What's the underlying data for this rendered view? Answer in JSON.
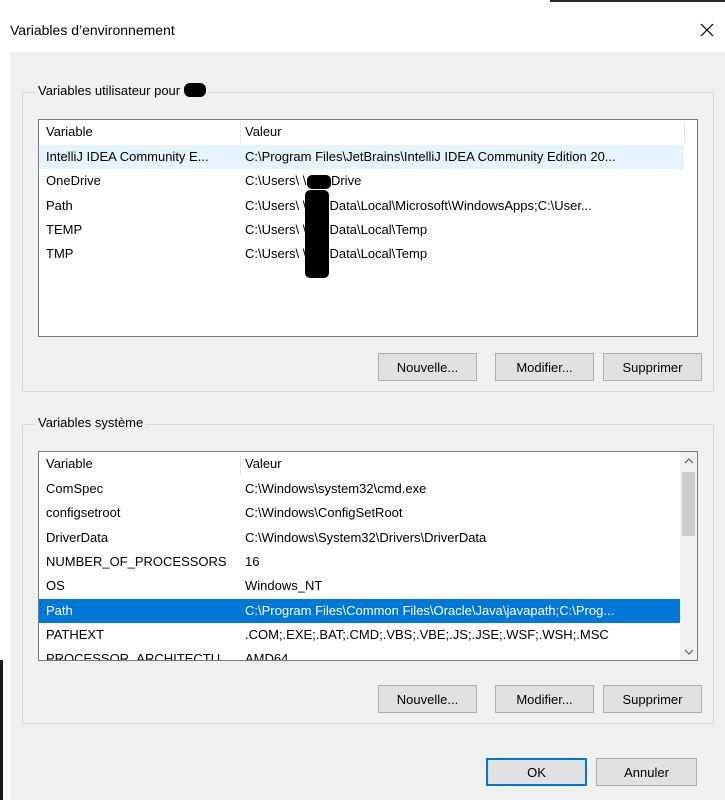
{
  "window": {
    "title": "Variables d’environnement",
    "close_glyph": "✕"
  },
  "user_section": {
    "legend": "Variables utilisateur pour",
    "columns": [
      "Variable",
      "Valeur"
    ],
    "rows": [
      {
        "name": "IntelliJ IDEA Community E...",
        "value": "C:\\Program Files\\JetBrains\\IntelliJ IDEA Community Edition 20..."
      },
      {
        "name": "OneDrive",
        "value": "C:\\Users\\      \\OneDrive"
      },
      {
        "name": "Path",
        "value": "C:\\Users\\      \\AppData\\Local\\Microsoft\\WindowsApps;C:\\User..."
      },
      {
        "name": "TEMP",
        "value": "C:\\Users\\      \\AppData\\Local\\Temp"
      },
      {
        "name": "TMP",
        "value": "C:\\Users\\      \\AppData\\Local\\Temp"
      }
    ],
    "buttons": {
      "new": "Nouvelle...",
      "edit": "Modifier...",
      "delete": "Supprimer"
    }
  },
  "system_section": {
    "legend": "Variables système",
    "columns": [
      "Variable",
      "Valeur"
    ],
    "rows": [
      {
        "name": "ComSpec",
        "value": "C:\\Windows\\system32\\cmd.exe"
      },
      {
        "name": "configsetroot",
        "value": "C:\\Windows\\ConfigSetRoot"
      },
      {
        "name": "DriverData",
        "value": "C:\\Windows\\System32\\Drivers\\DriverData"
      },
      {
        "name": "NUMBER_OF_PROCESSORS",
        "value": "16"
      },
      {
        "name": "OS",
        "value": "Windows_NT"
      },
      {
        "name": "Path",
        "value": "C:\\Program Files\\Common Files\\Oracle\\Java\\javapath;C:\\Prog..."
      },
      {
        "name": "PATHEXT",
        "value": ".COM;.EXE;.BAT;.CMD;.VBS;.VBE;.JS;.JSE;.WSF;.WSH;.MSC"
      },
      {
        "name": "PROCESSOR_ARCHITECTU...",
        "value": "AMD64"
      }
    ],
    "selected_row": 5,
    "buttons": {
      "new": "Nouvelle...",
      "edit": "Modifier...",
      "delete": "Supprimer"
    }
  },
  "footer": {
    "ok": "OK",
    "cancel": "Annuler"
  },
  "colors": {
    "selection": "#0078d7",
    "hover": "#e5f3ff",
    "dialog_bg": "#f0f0f0",
    "button_bg": "#e1e1e1"
  },
  "icons": {
    "close": "close-icon",
    "scroll_up": "chevron-up-icon",
    "scroll_down": "chevron-down-icon"
  }
}
